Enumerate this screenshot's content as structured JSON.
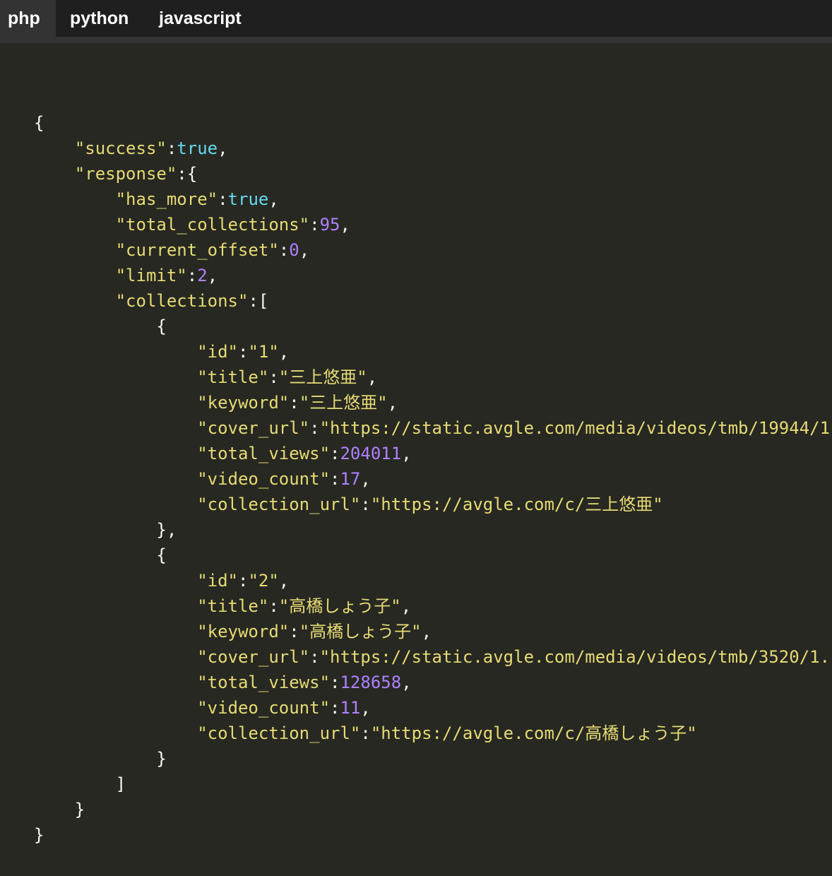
{
  "tabs": [
    {
      "label": "php",
      "active": true
    },
    {
      "label": "python",
      "active": false
    },
    {
      "label": "javascript",
      "active": false
    }
  ],
  "colors": {
    "background": "#272822",
    "tab_bar": "#1f1f1f",
    "active_tab": "#333333",
    "string": "#e6db74",
    "boolean": "#66d9ef",
    "number": "#ae81ff",
    "punctuation": "#f8f8f2"
  },
  "code_lines": [
    [
      {
        "t": "pun",
        "v": "{"
      }
    ],
    [
      {
        "t": "pun",
        "v": "    "
      },
      {
        "t": "str",
        "v": "\"success\""
      },
      {
        "t": "pun",
        "v": ":"
      },
      {
        "t": "kw",
        "v": "true"
      },
      {
        "t": "pun",
        "v": ","
      }
    ],
    [
      {
        "t": "pun",
        "v": "    "
      },
      {
        "t": "str",
        "v": "\"response\""
      },
      {
        "t": "pun",
        "v": ":{"
      }
    ],
    [
      {
        "t": "pun",
        "v": "        "
      },
      {
        "t": "str",
        "v": "\"has_more\""
      },
      {
        "t": "pun",
        "v": ":"
      },
      {
        "t": "kw",
        "v": "true"
      },
      {
        "t": "pun",
        "v": ","
      }
    ],
    [
      {
        "t": "pun",
        "v": "        "
      },
      {
        "t": "str",
        "v": "\"total_collections\""
      },
      {
        "t": "pun",
        "v": ":"
      },
      {
        "t": "num",
        "v": "95"
      },
      {
        "t": "pun",
        "v": ","
      }
    ],
    [
      {
        "t": "pun",
        "v": "        "
      },
      {
        "t": "str",
        "v": "\"current_offset\""
      },
      {
        "t": "pun",
        "v": ":"
      },
      {
        "t": "num",
        "v": "0"
      },
      {
        "t": "pun",
        "v": ","
      }
    ],
    [
      {
        "t": "pun",
        "v": "        "
      },
      {
        "t": "str",
        "v": "\"limit\""
      },
      {
        "t": "pun",
        "v": ":"
      },
      {
        "t": "num",
        "v": "2"
      },
      {
        "t": "pun",
        "v": ","
      }
    ],
    [
      {
        "t": "pun",
        "v": "        "
      },
      {
        "t": "str",
        "v": "\"collections\""
      },
      {
        "t": "pun",
        "v": ":["
      }
    ],
    [
      {
        "t": "pun",
        "v": "            {"
      }
    ],
    [
      {
        "t": "pun",
        "v": "                "
      },
      {
        "t": "str",
        "v": "\"id\""
      },
      {
        "t": "pun",
        "v": ":"
      },
      {
        "t": "str",
        "v": "\"1\""
      },
      {
        "t": "pun",
        "v": ","
      }
    ],
    [
      {
        "t": "pun",
        "v": "                "
      },
      {
        "t": "str",
        "v": "\"title\""
      },
      {
        "t": "pun",
        "v": ":"
      },
      {
        "t": "str",
        "v": "\"三上悠亜\""
      },
      {
        "t": "pun",
        "v": ","
      }
    ],
    [
      {
        "t": "pun",
        "v": "                "
      },
      {
        "t": "str",
        "v": "\"keyword\""
      },
      {
        "t": "pun",
        "v": ":"
      },
      {
        "t": "str",
        "v": "\"三上悠亜\""
      },
      {
        "t": "pun",
        "v": ","
      }
    ],
    [
      {
        "t": "pun",
        "v": "                "
      },
      {
        "t": "str",
        "v": "\"cover_url\""
      },
      {
        "t": "pun",
        "v": ":"
      },
      {
        "t": "str",
        "v": "\"https://static.avgle.com/media/videos/tmb/19944/1"
      }
    ],
    [
      {
        "t": "pun",
        "v": "                "
      },
      {
        "t": "str",
        "v": "\"total_views\""
      },
      {
        "t": "pun",
        "v": ":"
      },
      {
        "t": "num",
        "v": "204011"
      },
      {
        "t": "pun",
        "v": ","
      }
    ],
    [
      {
        "t": "pun",
        "v": "                "
      },
      {
        "t": "str",
        "v": "\"video_count\""
      },
      {
        "t": "pun",
        "v": ":"
      },
      {
        "t": "num",
        "v": "17"
      },
      {
        "t": "pun",
        "v": ","
      }
    ],
    [
      {
        "t": "pun",
        "v": "                "
      },
      {
        "t": "str",
        "v": "\"collection_url\""
      },
      {
        "t": "pun",
        "v": ":"
      },
      {
        "t": "str",
        "v": "\"https://avgle.com/c/三上悠亜\""
      }
    ],
    [
      {
        "t": "pun",
        "v": "            },"
      }
    ],
    [
      {
        "t": "pun",
        "v": "            {"
      }
    ],
    [
      {
        "t": "pun",
        "v": "                "
      },
      {
        "t": "str",
        "v": "\"id\""
      },
      {
        "t": "pun",
        "v": ":"
      },
      {
        "t": "str",
        "v": "\"2\""
      },
      {
        "t": "pun",
        "v": ","
      }
    ],
    [
      {
        "t": "pun",
        "v": "                "
      },
      {
        "t": "str",
        "v": "\"title\""
      },
      {
        "t": "pun",
        "v": ":"
      },
      {
        "t": "str",
        "v": "\"高橋しょう子\""
      },
      {
        "t": "pun",
        "v": ","
      }
    ],
    [
      {
        "t": "pun",
        "v": "                "
      },
      {
        "t": "str",
        "v": "\"keyword\""
      },
      {
        "t": "pun",
        "v": ":"
      },
      {
        "t": "str",
        "v": "\"高橋しょう子\""
      },
      {
        "t": "pun",
        "v": ","
      }
    ],
    [
      {
        "t": "pun",
        "v": "                "
      },
      {
        "t": "str",
        "v": "\"cover_url\""
      },
      {
        "t": "pun",
        "v": ":"
      },
      {
        "t": "str",
        "v": "\"https://static.avgle.com/media/videos/tmb/3520/1."
      }
    ],
    [
      {
        "t": "pun",
        "v": "                "
      },
      {
        "t": "str",
        "v": "\"total_views\""
      },
      {
        "t": "pun",
        "v": ":"
      },
      {
        "t": "num",
        "v": "128658"
      },
      {
        "t": "pun",
        "v": ","
      }
    ],
    [
      {
        "t": "pun",
        "v": "                "
      },
      {
        "t": "str",
        "v": "\"video_count\""
      },
      {
        "t": "pun",
        "v": ":"
      },
      {
        "t": "num",
        "v": "11"
      },
      {
        "t": "pun",
        "v": ","
      }
    ],
    [
      {
        "t": "pun",
        "v": "                "
      },
      {
        "t": "str",
        "v": "\"collection_url\""
      },
      {
        "t": "pun",
        "v": ":"
      },
      {
        "t": "str",
        "v": "\"https://avgle.com/c/高橋しょう子\""
      }
    ],
    [
      {
        "t": "pun",
        "v": "            }"
      }
    ],
    [
      {
        "t": "pun",
        "v": "        ]"
      }
    ],
    [
      {
        "t": "pun",
        "v": "    }"
      }
    ],
    [
      {
        "t": "pun",
        "v": "}"
      }
    ]
  ]
}
